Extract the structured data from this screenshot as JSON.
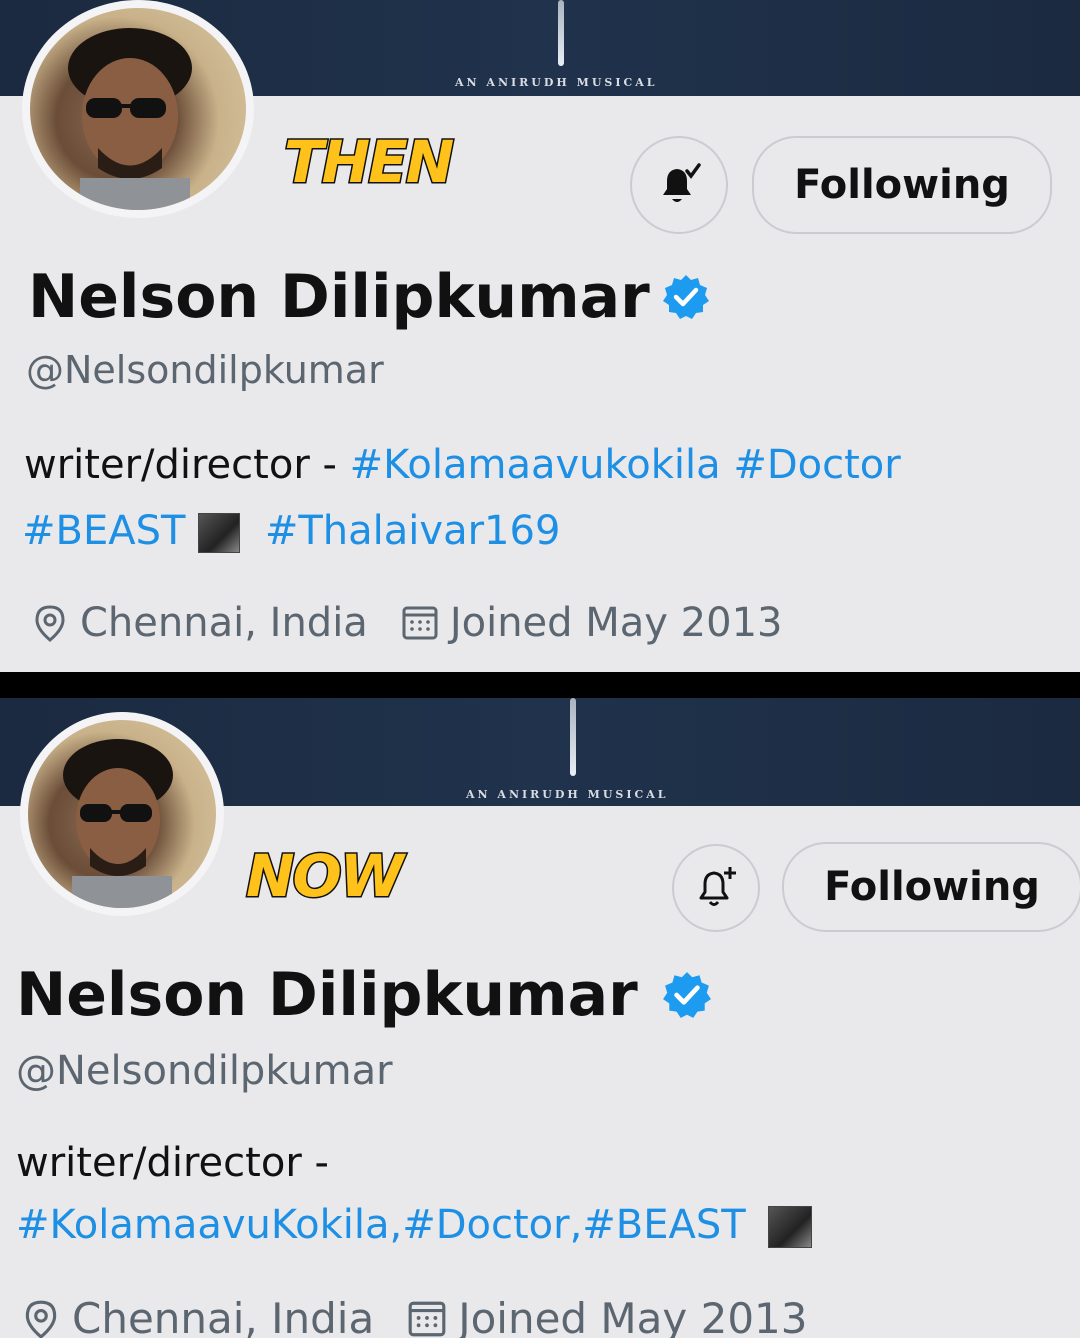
{
  "then": {
    "label": "THEN",
    "banner_text": "AN ANIRUDH MUSICAL",
    "follow_label": "Following",
    "bell_state": "bell-filled-checked-icon",
    "name": "Nelson Dilipkumar",
    "handle": "@Nelsondilpkumar",
    "bio_prefix": "writer/director - ",
    "bio_tags_line1": [
      "#Kolamaavukokila",
      "#Doctor"
    ],
    "bio_tag_beast": "#BEAST",
    "bio_tag_extra": "#Thalaivar169",
    "location": "Chennai, India",
    "joined": "Joined May 2013"
  },
  "now": {
    "label": "NOW",
    "banner_text": "AN ANIRUDH MUSICAL",
    "follow_label": "Following",
    "bell_state": "bell-plus-icon",
    "name": "Nelson Dilipkumar",
    "handle": "@Nelsondilpkumar",
    "bio_prefix": "writer/director -",
    "bio_tags": "#KolamaavuKokila,#Doctor,#BEAST",
    "location": "Chennai, India",
    "joined": "Joined May 2013"
  },
  "colors": {
    "link": "#1d8fe4",
    "verified": "#1d9bf0",
    "tag": "#ffc21a",
    "background": "#e9e9ec"
  }
}
